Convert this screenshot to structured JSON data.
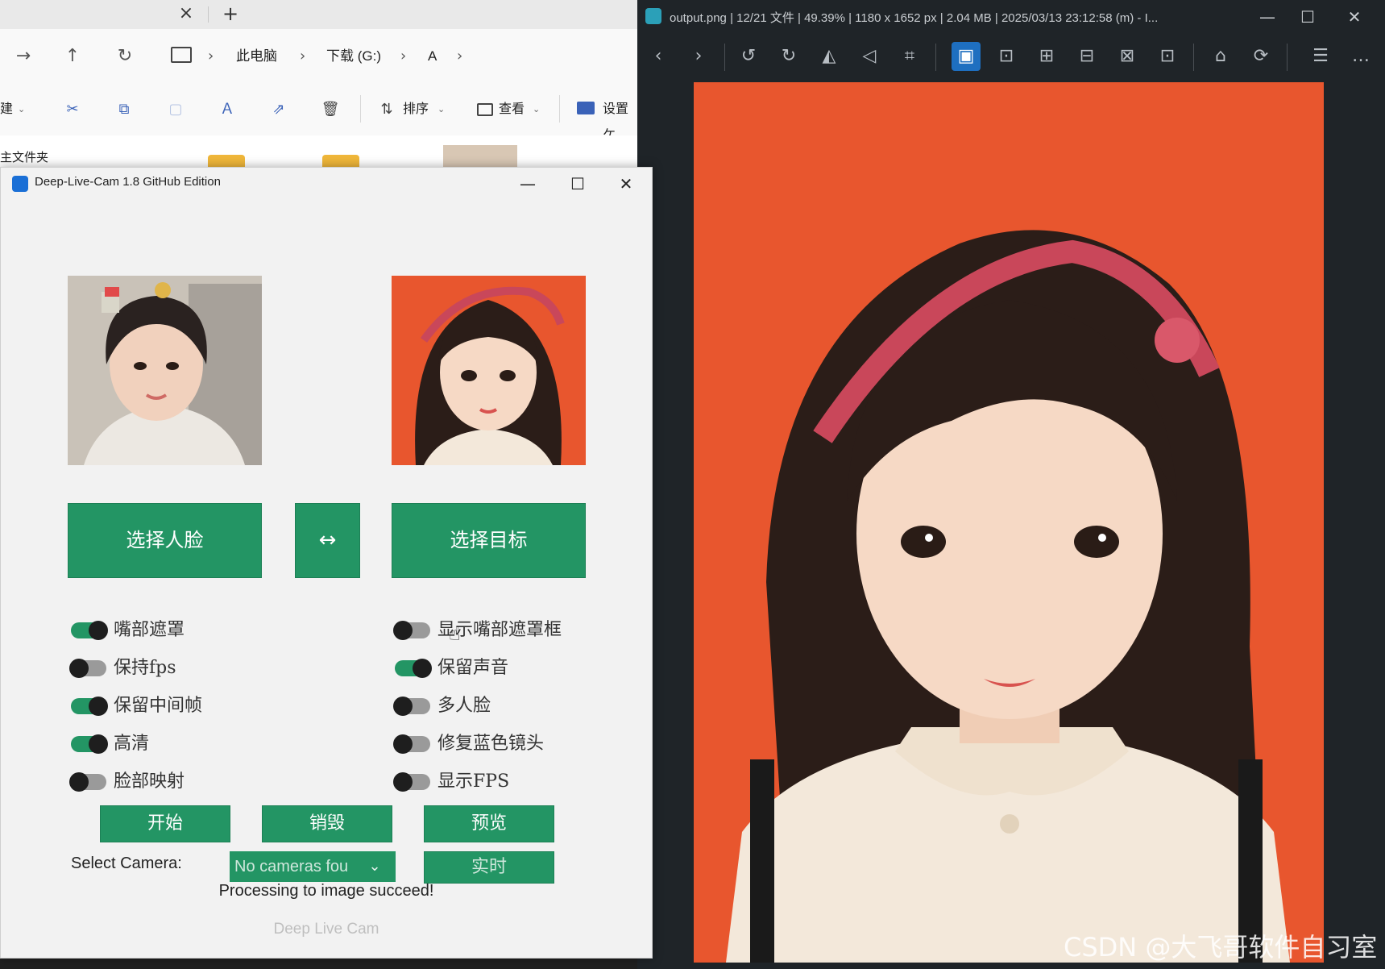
{
  "explorer": {
    "tab_close": "×",
    "tab_new": "+",
    "nav": {
      "forward": "→",
      "up": "↑",
      "refresh": "↻"
    },
    "breadcrumb": [
      "此电脑",
      "下载 (G:)",
      "A"
    ],
    "commands": {
      "new_fragment": "建",
      "sort": "排序",
      "view": "查看",
      "settings": "设置ケ"
    },
    "content_label": "主文件夹"
  },
  "dlc": {
    "title": "Deep-Live-Cam 1.8 GitHub Edition",
    "buttons": {
      "select_face": "选择人脸",
      "swap": "↔",
      "select_target": "选择目标",
      "start": "开始",
      "destroy": "销毁",
      "preview": "预览",
      "live": "实时"
    },
    "switches_left": [
      {
        "label": "嘴部遮罩",
        "on": true
      },
      {
        "label": "保持fps",
        "on": false
      },
      {
        "label": "保留中间帧",
        "on": true
      },
      {
        "label": "高清",
        "on": true
      },
      {
        "label": "脸部映射",
        "on": false
      }
    ],
    "switches_right": [
      {
        "label": "显示嘴部遮罩框",
        "on": false
      },
      {
        "label": "保留声音",
        "on": true
      },
      {
        "label": "多人脸",
        "on": false
      },
      {
        "label": "修复蓝色镜头",
        "on": false
      },
      {
        "label": "显示FPS",
        "on": false
      }
    ],
    "camera_label": "Select Camera:",
    "camera_value": "No cameras fou",
    "status": "Processing to image succeed!",
    "footer": "Deep Live Cam"
  },
  "viewer": {
    "title": "output.png | 12/21 文件 | 49.39% | 1180 x 1652 px | 2.04 MB | 2025/03/13 23:12:58 (m) - I...",
    "canvas_color": "#e8562e"
  },
  "watermark": "CSDN @大飞哥软件自习室",
  "colors": {
    "accent_green": "#239564",
    "viewer_bg": "#1f2428",
    "active_tool": "#1e6fc0"
  }
}
